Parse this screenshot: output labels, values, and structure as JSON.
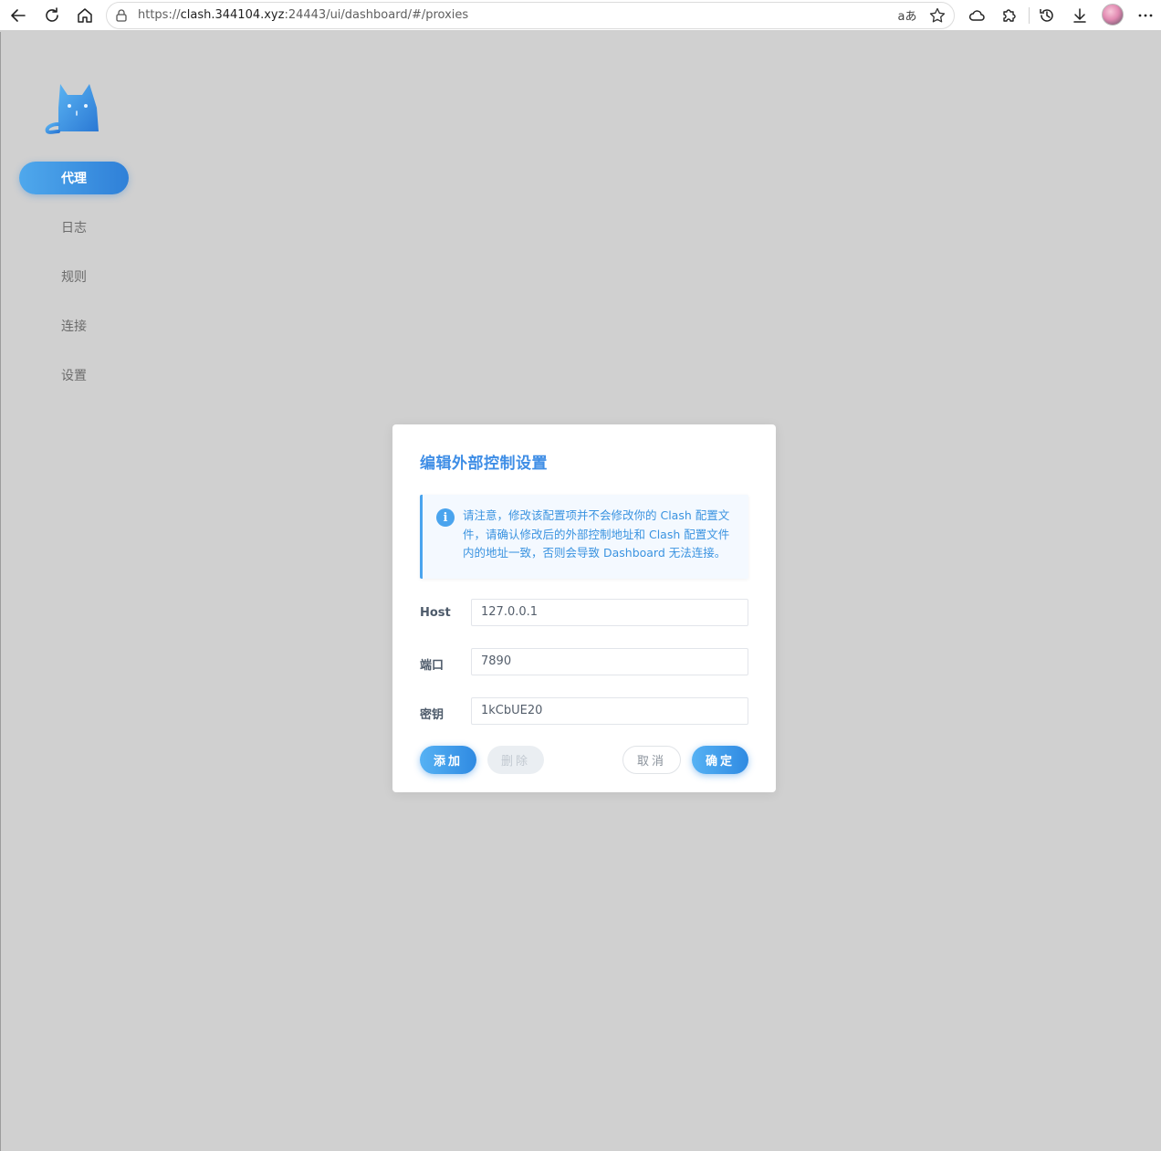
{
  "browser": {
    "url_prefix": "https://",
    "url_host": "clash.344104.xyz",
    "url_rest": ":24443/ui/dashboard/#/proxies",
    "read_aloud": "aあ"
  },
  "sidebar": {
    "items": [
      {
        "label": "代理",
        "active": true
      },
      {
        "label": "日志",
        "active": false
      },
      {
        "label": "规则",
        "active": false
      },
      {
        "label": "连接",
        "active": false
      },
      {
        "label": "设置",
        "active": false
      }
    ]
  },
  "dialog": {
    "title": "编辑外部控制设置",
    "alert_icon": "i",
    "alert_lines": [
      "请注意，修改该配置项并不会修改你的 Clash 配置文",
      "件，请确认修改后的外部控制地址和 Clash 配置文件",
      "内的地址一致，否则会导致 Dashboard 无法连接。"
    ],
    "fields": {
      "host": {
        "label": "Host",
        "value": "127.0.0.1"
      },
      "port": {
        "label": "端口",
        "value": "7890"
      },
      "secret": {
        "label": "密钥",
        "value": "1kCbUE20"
      }
    },
    "buttons": {
      "add": "添加",
      "delete": "删除",
      "cancel": "取消",
      "confirm": "确定"
    }
  },
  "colors": {
    "accent": "#3f8ee6",
    "overlay": "#d0d0d0"
  }
}
